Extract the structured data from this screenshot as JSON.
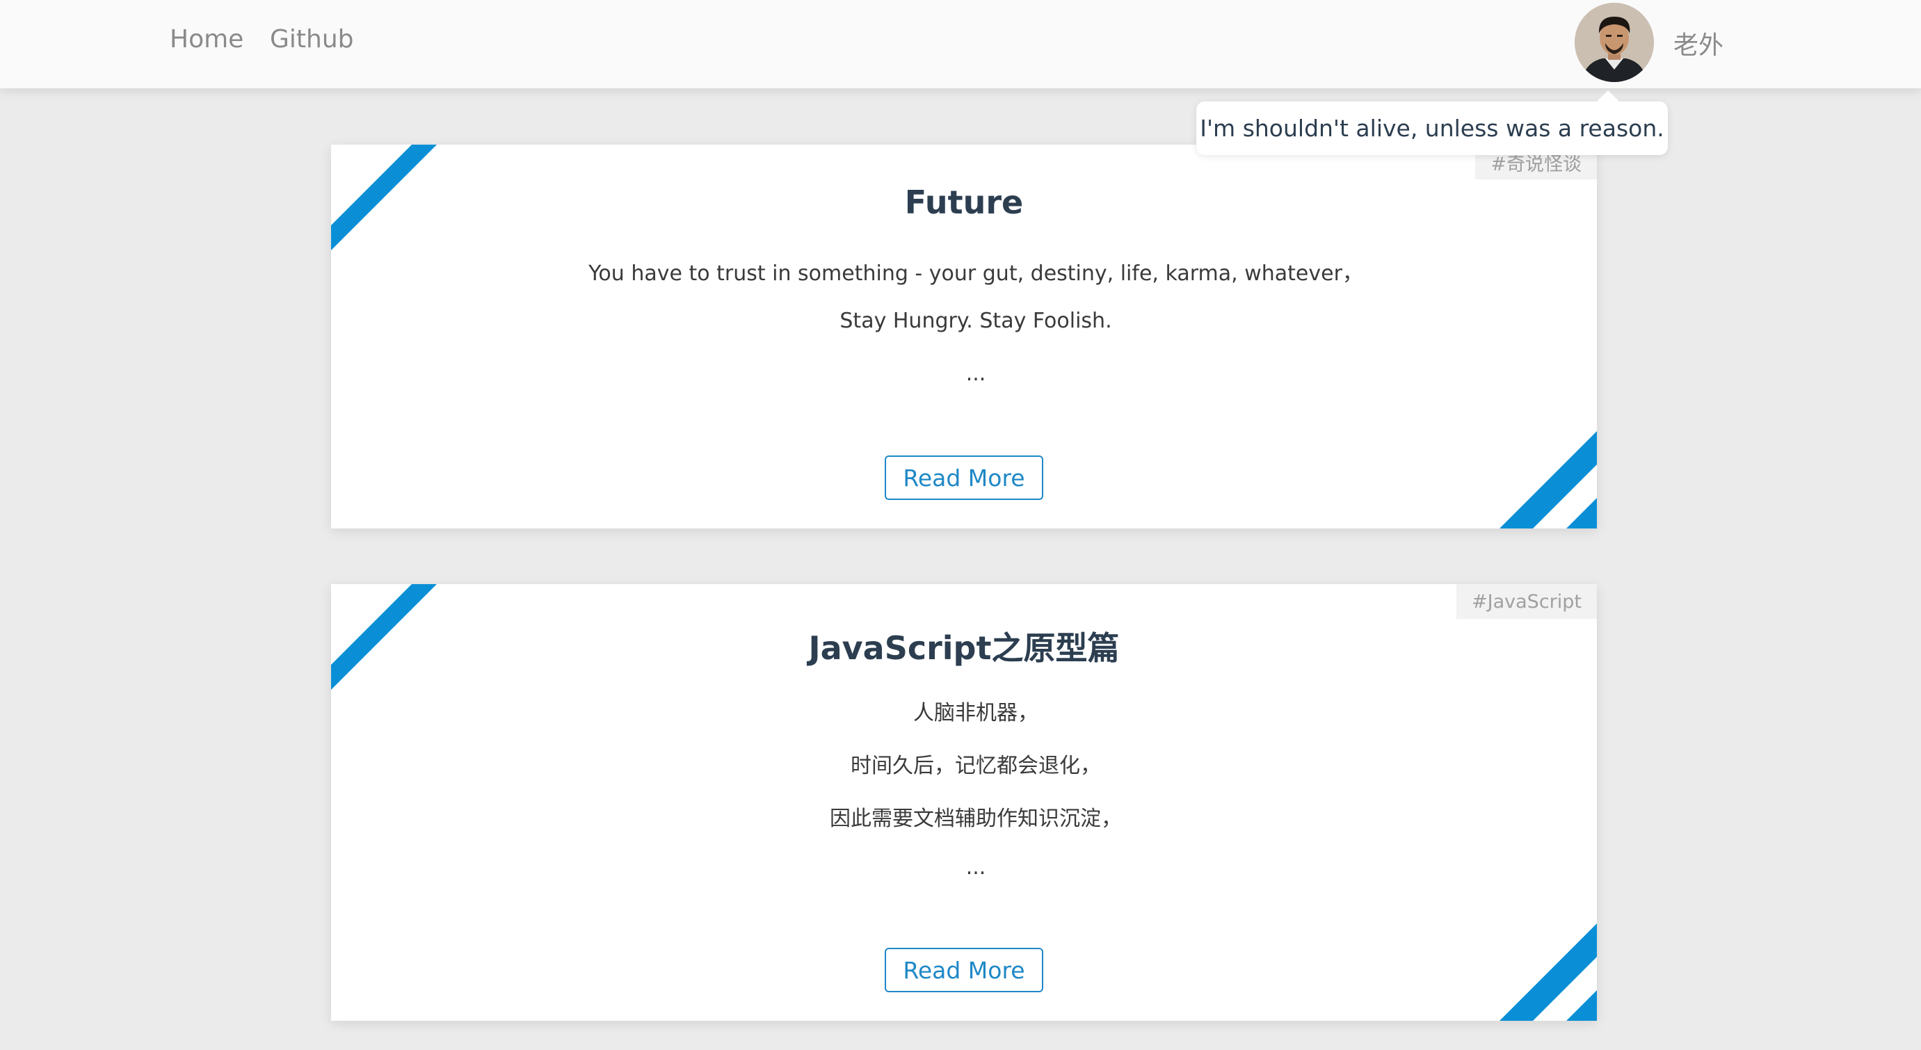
{
  "nav": {
    "home_label": "Home",
    "github_label": "Github"
  },
  "user": {
    "name": "老外",
    "motto": "I'm shouldn't alive, unless was a reason."
  },
  "posts": [
    {
      "tag": "#奇说怪谈",
      "title": "Future",
      "excerpt": [
        "You have to trust in something - your gut, destiny, life, karma, whatever，",
        "Stay Hungry. Stay Foolish.",
        "..."
      ],
      "read_more_label": "Read More"
    },
    {
      "tag": "#JavaScript",
      "title": "JavaScript之原型篇",
      "excerpt": [
        "人脑非机器，",
        "时间久后，记忆都会退化，",
        "因此需要文档辅助作知识沉淀，",
        "..."
      ],
      "read_more_label": "Read More"
    }
  ],
  "colors": {
    "accent": "#0a8fd6",
    "link": "#1e88c7",
    "background": "#ebebeb",
    "nav_background": "#fafafa"
  }
}
